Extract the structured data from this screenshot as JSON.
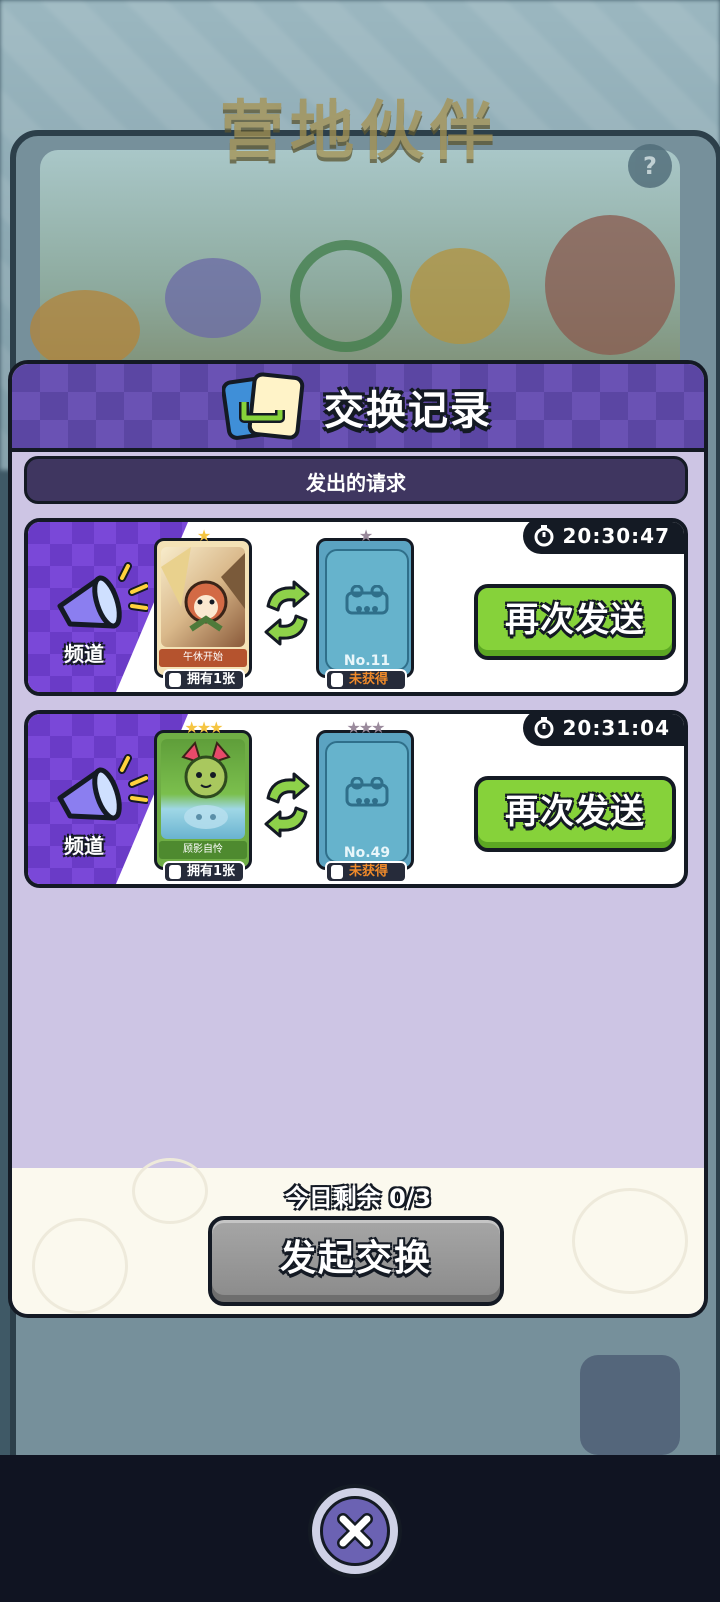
{
  "background": {
    "title": "营地伙伴",
    "subtitle": "",
    "caption": "",
    "help_icon": "?"
  },
  "dialog": {
    "title": "交换记录",
    "section_label": "发出的请求",
    "requests": [
      {
        "channel_label": "频道",
        "timer": "20:30:47",
        "offered_card": {
          "name": "午休开始",
          "stars": "★",
          "owned": "拥有1张"
        },
        "wanted_card": {
          "number": "No.11",
          "stars": "★",
          "status": "未获得"
        },
        "resend_label": "再次发送"
      },
      {
        "channel_label": "频道",
        "timer": "20:31:04",
        "offered_card": {
          "name": "顾影自怜",
          "stars": "★★★",
          "owned": "拥有1张"
        },
        "wanted_card": {
          "number": "No.49",
          "stars": "★★★",
          "status": "未获得"
        },
        "resend_label": "再次发送"
      }
    ],
    "remaining_text": "今日剩余 0/3",
    "start_exchange_label": "发起交换"
  },
  "colors": {
    "accent_purple": "#6a52b4",
    "button_green": "#86d23a",
    "button_disabled": "#8a8a8a",
    "missing_orange": "#f08a2a"
  },
  "icons": [
    "card-exchange-icon",
    "megaphone-icon",
    "stopwatch-icon",
    "swap-arrows-icon",
    "star-icon",
    "close-icon"
  ]
}
